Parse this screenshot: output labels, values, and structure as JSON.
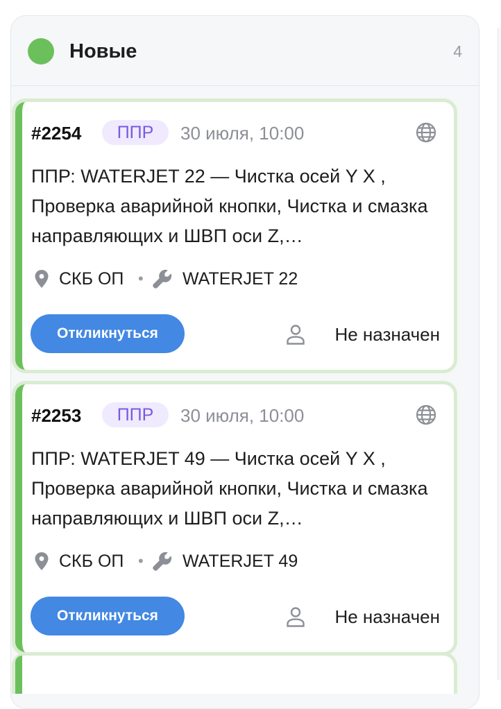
{
  "column": {
    "title": "Новые",
    "count": "4",
    "status_color": "#6cc05c"
  },
  "cards": [
    {
      "id": "#2254",
      "type": "ППР",
      "date": "30 июля, 10:00",
      "description": "ППР: WATERJET 22 — Чистка осей Y X , Проверка аварийной кнопки, Чистка и смазка направляющих и ШВП оси Z,…",
      "location": "СКБ ОП",
      "separator": "•",
      "equipment": "WATERJET 22",
      "action_label": "Откликнуться",
      "assignee": "Не назначен"
    },
    {
      "id": "#2253",
      "type": "ППР",
      "date": "30 июля, 10:00",
      "description": "ППР: WATERJET 49 — Чистка осей Y X , Проверка аварийной кнопки, Чистка и смазка направляющих и ШВП оси Z,…",
      "location": "СКБ ОП",
      "separator": "•",
      "equipment": "WATERJET 49",
      "action_label": "Откликнуться",
      "assignee": "Не назначен"
    }
  ],
  "icons": {
    "status": "green-circle",
    "type_scope": "globe-icon",
    "location": "map-pin-icon",
    "equipment": "wrench-icon",
    "assignee": "user-icon"
  },
  "colors": {
    "accent": "#4388e2",
    "card_stripe": "#6cc05c",
    "card_border": "#d9ecd2",
    "badge_bg": "#efeafd",
    "badge_text": "#7a5ae0"
  }
}
